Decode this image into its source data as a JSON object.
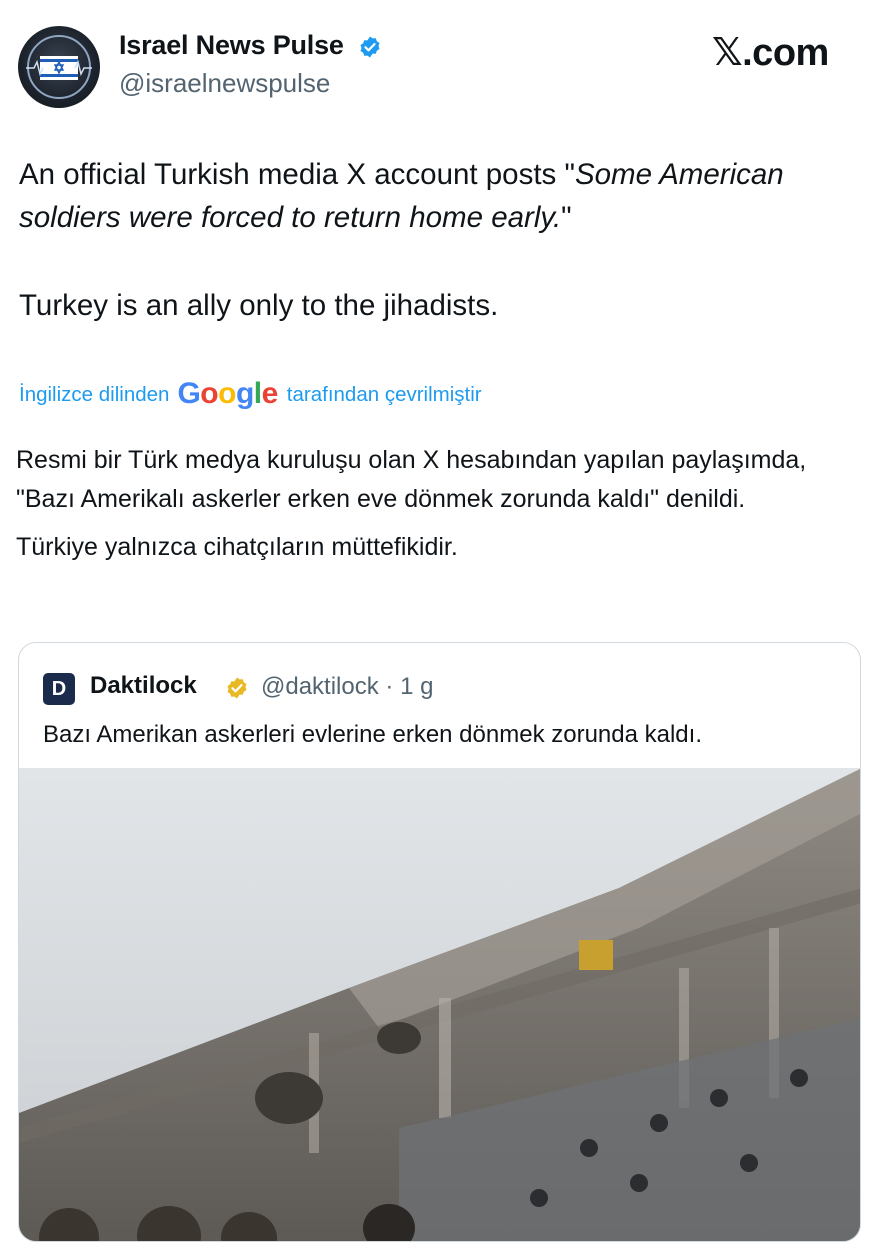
{
  "header": {
    "author_name": "Israel News Pulse",
    "author_handle": "@israelnewspulse",
    "verified_color": "#1d9bf0",
    "brand_x": "𝕏",
    "brand_suffix": ".com"
  },
  "post": {
    "line1_prefix": "An official Turkish media X account posts \"",
    "line1_italic": "Some American soldiers were forced to return home early.",
    "line1_suffix": "\"",
    "line2": "Turkey is an ally only to the jihadists."
  },
  "translation": {
    "prefix": "İngilizce dilinden",
    "logo": "Google",
    "suffix": "tarafından çevrilmiştir",
    "link_color": "#1d9bf0",
    "paragraph1": "Resmi bir Türk medya kuruluşu olan X hesabından yapılan paylaşımda, \"Bazı Amerikalı askerler erken eve dönmek zorunda kaldı\" denildi.",
    "paragraph2": "Türkiye yalnızca cihatçıların müttefikidir."
  },
  "quoted": {
    "avatar_glyph": "D",
    "name": "Daktilock",
    "handle": "@daktilock",
    "separator": "·",
    "time": "1 g",
    "badge_color": "#e8b923",
    "text": "Bazı Amerikan askerleri evlerine erken dönmek zorunda kaldı."
  },
  "media": {
    "description_icon": "video-thumbnail"
  }
}
